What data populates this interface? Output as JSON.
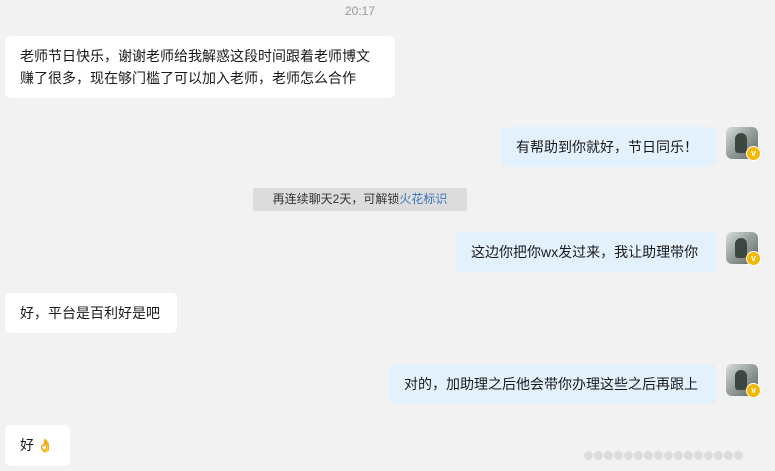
{
  "chat": {
    "timestamp": "20:17",
    "messages": [
      {
        "side": "left",
        "lines": [
          "老师节日快乐，谢谢老师给我解惑这段时间跟着老师博文",
          "赚了很多，现在够门槛了可以加入老师，老师怎么合作"
        ]
      },
      {
        "side": "right",
        "text": "有帮助到你就好，节日同乐！"
      },
      {
        "side": "right",
        "text": "这边你把你wx发过来，我让助理带你"
      },
      {
        "side": "left",
        "text": "好，平台是百利好是吧"
      },
      {
        "side": "right",
        "text": "对的，加助理之后他会带你办理这些之后再跟上"
      },
      {
        "side": "left",
        "text": "好",
        "emoji": "👌"
      }
    ],
    "system_notice": {
      "prefix": "再连续聊天2天，可解锁",
      "link": "火花标识"
    }
  },
  "colors": {
    "background": "#f2f2f2",
    "left_bubble": "#ffffff",
    "right_bubble": "#e3f1fd",
    "link": "#3a74b8",
    "verified_badge": "#f5b800"
  },
  "icons": {
    "avatar": "user-avatar",
    "verified": "verified-v-badge"
  }
}
